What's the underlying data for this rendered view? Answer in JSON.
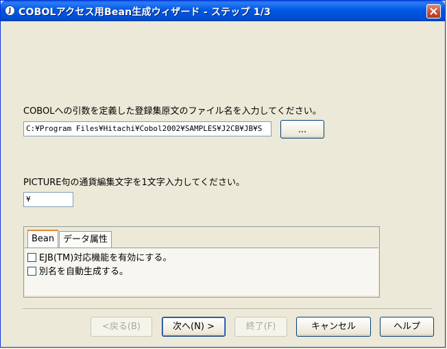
{
  "window": {
    "title": "COBOLアクセス用Bean生成ウィザード - ステップ 1/3"
  },
  "file_section": {
    "prompt": "COBOLへの引数を定義した登録集原文のファイル名を入力してください。",
    "path_value": "C:¥Program Files¥Hitachi¥Cobol2002¥SAMPLES¥J2CB¥JB¥S",
    "browse_label": "..."
  },
  "currency_section": {
    "prompt": "PICTURE句の通貨編集文字を1文字入力してください。",
    "value": "¥"
  },
  "tabs": {
    "items": [
      {
        "label": "Bean",
        "active": true
      },
      {
        "label": "データ属性",
        "active": false
      }
    ],
    "options": [
      {
        "label": "EJB(TM)対応機能を有効にする。",
        "checked": false
      },
      {
        "label": "別名を自動生成する。",
        "checked": false
      }
    ]
  },
  "buttons": {
    "back": "<戻る(B)",
    "next": "次へ(N) >",
    "finish": "終了(F)",
    "cancel": "キャンセル",
    "help": "ヘルプ"
  }
}
